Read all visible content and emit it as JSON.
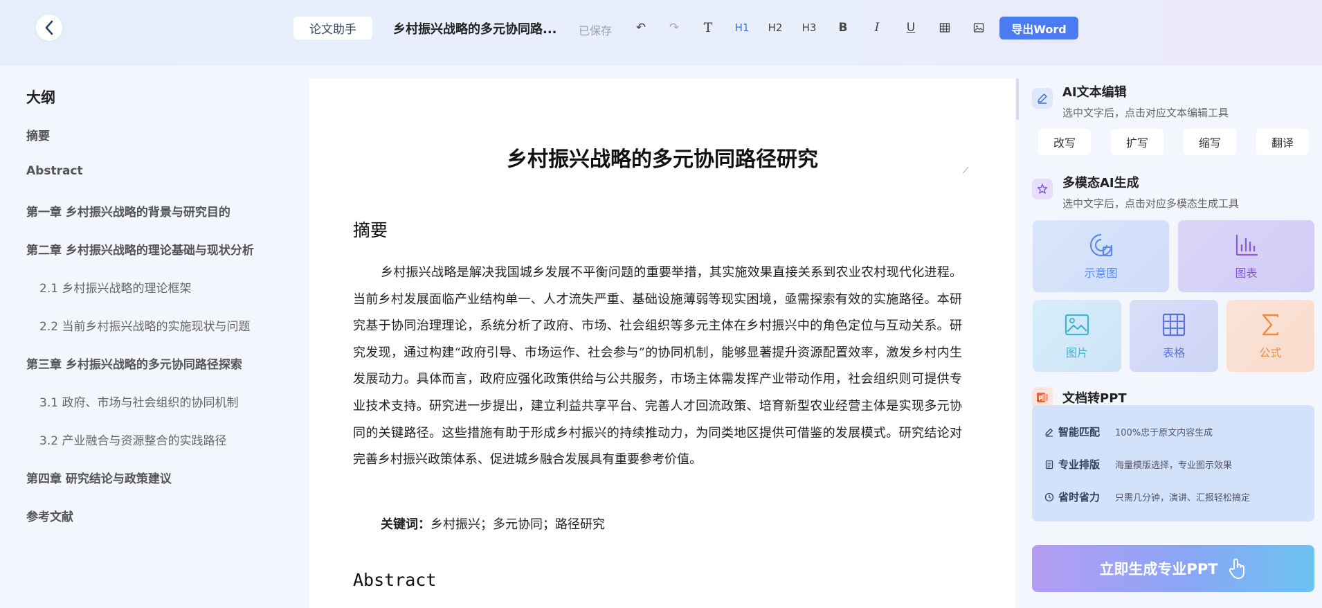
{
  "header": {
    "assistant_label": "论文助手",
    "doc_title": "乡村振兴战略的多元协同路...",
    "saved_status": "已保存",
    "tools": {
      "undo": "↶",
      "redo": "↷",
      "text": "T",
      "h1": "H1",
      "h2": "H2",
      "h3": "H3",
      "bold": "B",
      "italic": "I",
      "underline": "U"
    },
    "export_label": "导出Word"
  },
  "outline": {
    "title": "大纲",
    "items": [
      {
        "label": "摘要"
      },
      {
        "label": "Abstract"
      },
      {
        "label": "第一章 乡村振兴战略的背景与研究目的"
      },
      {
        "label": "第二章 乡村振兴战略的理论基础与现状分析"
      },
      {
        "label": "2.1 乡村振兴战略的理论框架"
      },
      {
        "label": "2.2 当前乡村振兴战略的实施现状与问题"
      },
      {
        "label": "第三章 乡村振兴战略的多元协同路径探索"
      },
      {
        "label": "3.1 政府、市场与社会组织的协同机制"
      },
      {
        "label": "3.2 产业融合与资源整合的实践路径"
      },
      {
        "label": "第四章 研究结论与政策建议"
      },
      {
        "label": "参考文献"
      }
    ]
  },
  "document": {
    "title": "乡村振兴战略的多元协同路径研究",
    "abstract_heading": "摘要",
    "abstract_text": "乡村振兴战略是解决我国城乡发展不平衡问题的重要举措，其实施效果直接关系到农业农村现代化进程。当前乡村发展面临产业结构单一、人才流失严重、基础设施薄弱等现实困境，亟需探索有效的实施路径。本研究基于协同治理理论，系统分析了政府、市场、社会组织等多元主体在乡村振兴中的角色定位与互动关系。研究发现，通过构建“政府引导、市场运作、社会参与”的协同机制，能够显著提升资源配置效率，激发乡村内生发展动力。具体而言，政府应强化政策供给与公共服务，市场主体需发挥产业带动作用，社会组织则可提供专业技术支持。研究进一步提出，建立利益共享平台、完善人才回流政策、培育新型农业经营主体是实现多元协同的关键路径。这些措施有助于形成乡村振兴的持续推动力，为同类地区提供可借鉴的发展模式。研究结论对完善乡村振兴政策体系、促进城乡融合发展具有重要参考价值。",
    "keywords_label": "关键词：",
    "keywords": "乡村振兴；多元协同；路径研究",
    "abstract_en_heading": "Abstract"
  },
  "panel": {
    "ai_edit": {
      "title": "AI文本编辑",
      "subtitle": "选中文字后，点击对应文本编辑工具",
      "buttons": [
        "改写",
        "扩写",
        "缩写",
        "翻译"
      ]
    },
    "multimodal": {
      "title": "多模态AI生成",
      "subtitle": "选中文字后，点击对应多模态生成工具",
      "cards": [
        {
          "label": "示意图",
          "color": "#5b8ae6"
        },
        {
          "label": "图表",
          "color": "#8a5cd8"
        },
        {
          "label": "图片",
          "color": "#3fb5cf"
        },
        {
          "label": "表格",
          "color": "#5b74d8"
        },
        {
          "label": "公式",
          "color": "#f08a3c"
        }
      ]
    },
    "doc_to_ppt": {
      "title": "文档转PPT",
      "features": [
        {
          "title": "智能匹配",
          "desc": "100%忠于原文内容生成"
        },
        {
          "title": "专业排版",
          "desc": "海量模版选择，专业图示效果"
        },
        {
          "title": "省时省力",
          "desc": "只需几分钟，演讲、汇报轻松搞定"
        }
      ],
      "generate_label": "立即生成专业PPT"
    }
  }
}
